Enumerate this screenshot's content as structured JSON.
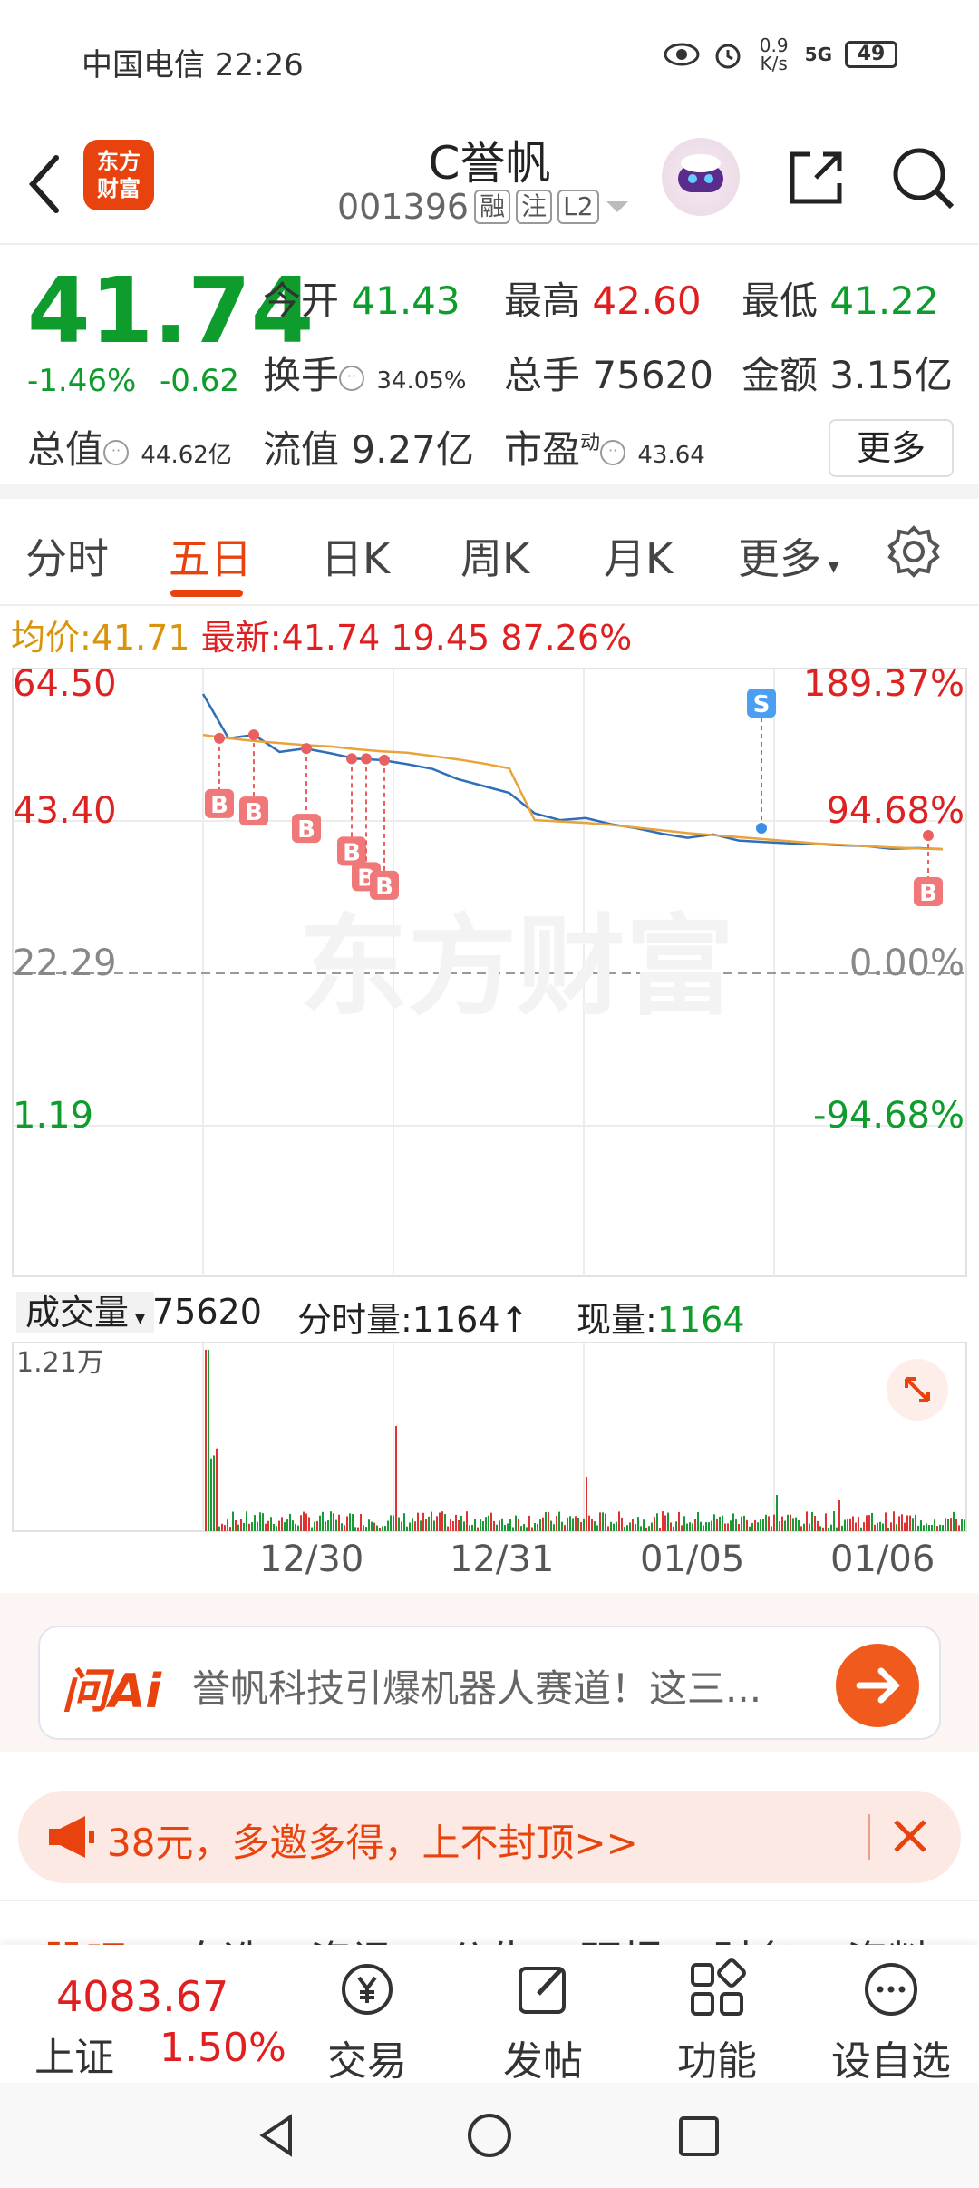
{
  "status": {
    "carrier_time": "中国电信 22:26",
    "net_speed": "0.9 K/s",
    "signal": "5G",
    "battery": "49"
  },
  "header": {
    "logo": "东方\n财富",
    "title": "C誉帆",
    "code": "001396",
    "tags": [
      "融",
      "注",
      "L2"
    ]
  },
  "quote": {
    "price": "41.74",
    "change_pct": "-1.46%",
    "change": "-0.62",
    "open_label": "今开",
    "open": "41.43",
    "high_label": "最高",
    "high": "42.60",
    "low_label": "最低",
    "low": "41.22",
    "turnover_label": "换手",
    "turnover": "34.05%",
    "vol_label": "总手",
    "vol": "75620",
    "amount_label": "金额",
    "amount": "3.15亿",
    "mcap_label": "总值",
    "mcap": "44.62亿",
    "float_label": "流值",
    "float": "9.27亿",
    "pe_label": "市盈",
    "pe_sup": "动",
    "pe": "43.64",
    "more": "更多"
  },
  "tabs": [
    "分时",
    "五日",
    "日K",
    "周K",
    "月K",
    "更多"
  ],
  "avg": {
    "avg_label": "均价:",
    "avg": "41.71",
    "latest_label": "最新:",
    "latest": "41.74",
    "v1": "19.45",
    "v2": "87.26%"
  },
  "chart_data": {
    "type": "line",
    "title": "",
    "y_left_ticks": [
      "64.50",
      "43.40",
      "22.29",
      "1.19"
    ],
    "y_right_ticks": [
      "189.37%",
      "94.68%",
      "0.00%",
      "-94.68%"
    ],
    "x_dates": [
      "12/30",
      "12/31",
      "01/05",
      "01/06"
    ],
    "ylim": [
      1.19,
      64.5
    ],
    "series": [
      {
        "color": "#2f6fba",
        "values": [
          64.5,
          58.0,
          58.5,
          56.0,
          56.5,
          55.8,
          55.0,
          54.8,
          54.2,
          53.5,
          52.0,
          51.0,
          50.0,
          47.0,
          46.0,
          46.3,
          45.4,
          44.8,
          44.0,
          43.4,
          43.9,
          43.0,
          42.8,
          42.6,
          42.5,
          42.3,
          42.2,
          41.8,
          41.9,
          41.74
        ]
      },
      {
        "color": "#e8a33a",
        "values": [
          58.5,
          58.0,
          57.6,
          57.3,
          57.0,
          56.8,
          56.4,
          56.1,
          55.9,
          55.4,
          54.9,
          54.3,
          53.6,
          46.0,
          45.8,
          45.6,
          45.3,
          44.9,
          44.5,
          44.1,
          43.8,
          43.5,
          43.2,
          42.9,
          42.6,
          42.4,
          42.2,
          42.0,
          41.85,
          41.71
        ]
      }
    ],
    "markers": [
      "B",
      "B",
      "B",
      "B",
      "B",
      "B",
      "S",
      "B"
    ],
    "watermark": "东方财富"
  },
  "volume": {
    "label": "成交量",
    "total": "75620",
    "tick_label": "分时量:1164↑",
    "now_label": "现量:",
    "now": "1164",
    "y_max": "1.21万"
  },
  "ai": {
    "logo": "问Ai",
    "text": "誉帆科技引爆机器人赛道！这三..."
  },
  "promo": {
    "text": "38元，多邀多得，上不封顶>>"
  },
  "subtabs": [
    "股吧",
    "自选",
    "资讯",
    "公告",
    "研报",
    "财务",
    "资料"
  ],
  "bottom": {
    "index_value": "4083.67",
    "index_name": "上证",
    "index_pct": "1.50%",
    "items": [
      "交易",
      "发帖",
      "功能",
      "设自选"
    ]
  }
}
